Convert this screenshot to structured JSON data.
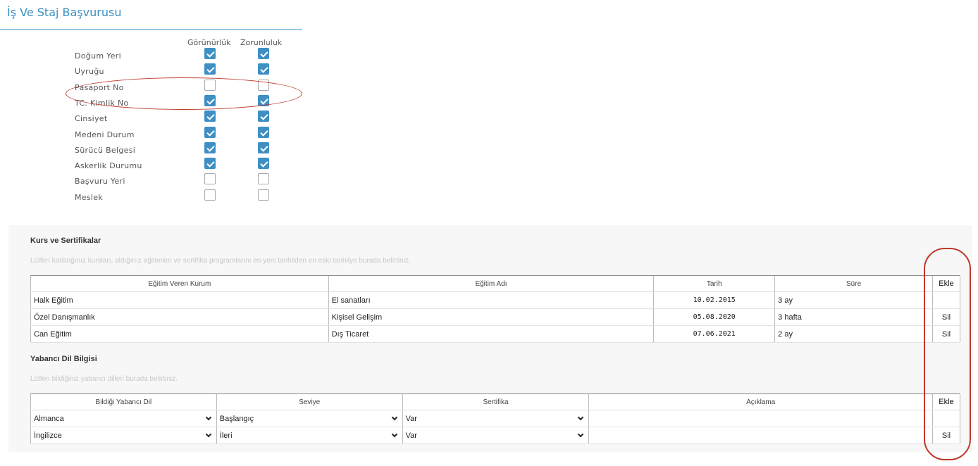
{
  "header": {
    "title": "İş Ve Staj Başvurusu"
  },
  "columns": {
    "visibility": "Görünürlük",
    "required": "Zorunluluk"
  },
  "fields": [
    {
      "label": "Doğum Yeri",
      "visible": true,
      "required": true
    },
    {
      "label": "Uyruğu",
      "visible": true,
      "required": true
    },
    {
      "label": "Pasaport No",
      "visible": false,
      "required": false
    },
    {
      "label": "TC. Kimlik No",
      "visible": true,
      "required": true
    },
    {
      "label": "Cinsiyet",
      "visible": true,
      "required": true
    },
    {
      "label": "Medeni Durum",
      "visible": true,
      "required": true
    },
    {
      "label": "Sürücü Belgesi",
      "visible": true,
      "required": true
    },
    {
      "label": "Askerlik Durumu",
      "visible": true,
      "required": true
    },
    {
      "label": "Başvuru Yeri",
      "visible": false,
      "required": false
    },
    {
      "label": "Meslek",
      "visible": false,
      "required": false
    }
  ],
  "courses": {
    "title": "Kurs ve Sertifikalar",
    "hint": "Lütfen katıldığınız kursları, aldığınız eğitimleri ve sertifika programlarını en yeni tarihliden en eski tarihliye burada belirtiniz.",
    "headers": {
      "institution": "Eğitim Veren Kurum",
      "name": "Eğitim Adı",
      "date": "Tarih",
      "duration": "Süre",
      "action": "Ekle"
    },
    "rows": [
      {
        "institution": "Halk Eğitim",
        "name": "El sanatları",
        "date": "10.02.2015",
        "duration": "3 ay",
        "action": ""
      },
      {
        "institution": "Özel Danışmanlık",
        "name": "Kişisel Gelişim",
        "date": "05.08.2020",
        "duration": "3 hafta",
        "action": "Sil"
      },
      {
        "institution": "Can Eğitim",
        "name": "Dış Ticaret",
        "date": "07.06.2021",
        "duration": "2 ay",
        "action": "Sil"
      }
    ]
  },
  "languages": {
    "title": "Yabancı Dil Bilgisi",
    "hint": "Lütfen bildiğiniz yabancı dilleri burada belirtiniz.",
    "headers": {
      "language": "Bildiği Yabancı Dil",
      "level": "Seviye",
      "certificate": "Sertifika",
      "description": "Açıklama",
      "action": "Ekle"
    },
    "rows": [
      {
        "language": "Almanca",
        "level": "Başlangıç",
        "certificate": "Var",
        "description": "",
        "action": ""
      },
      {
        "language": "İngilizce",
        "level": "İleri",
        "certificate": "Var",
        "description": "",
        "action": "Sil"
      }
    ]
  },
  "colors": {
    "accent": "#3a8fc2",
    "checkbox": "#3f8fc4",
    "annotation": "#c0392b"
  }
}
